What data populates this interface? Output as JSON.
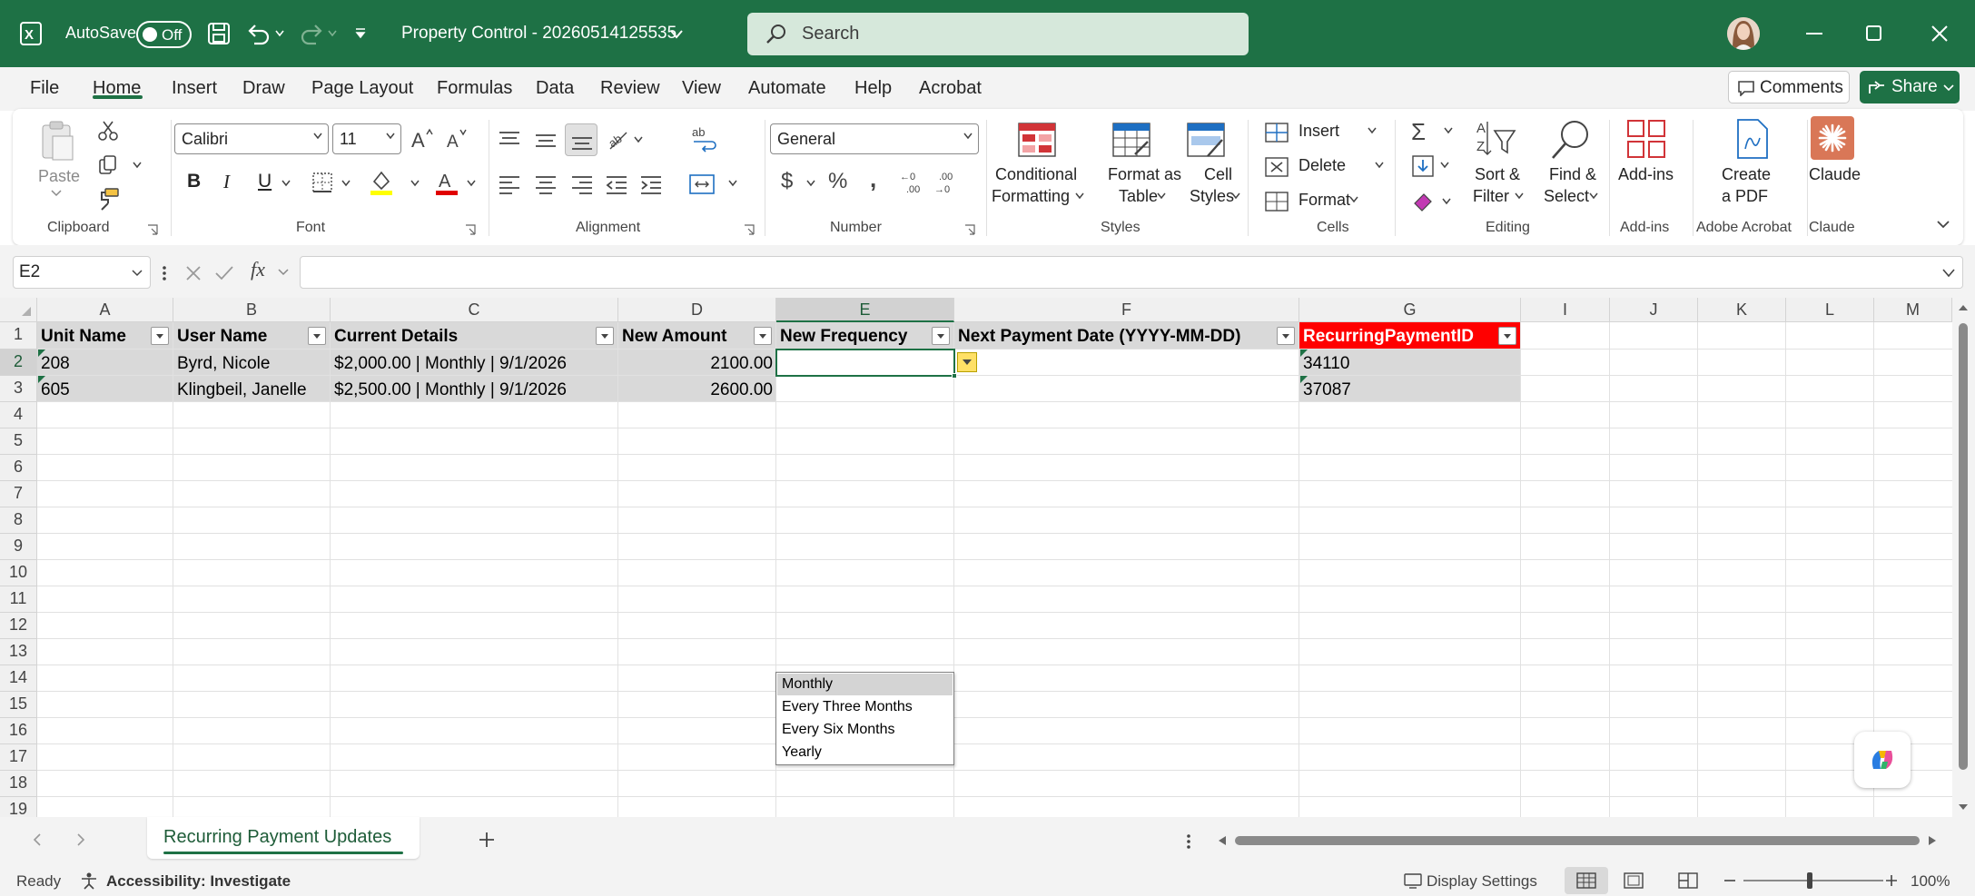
{
  "titlebar": {
    "autosave_label": "AutoSave",
    "autosave_state": "Off",
    "doc_title": "Property Control - 20260514125535",
    "search_placeholder": "Search",
    "accent": "#1e7145"
  },
  "menu": {
    "items": [
      "File",
      "Home",
      "Insert",
      "Draw",
      "Page Layout",
      "Formulas",
      "Data",
      "Review",
      "View",
      "Automate",
      "Help",
      "Acrobat"
    ],
    "active": "Home",
    "comments": "Comments",
    "share": "Share"
  },
  "ribbon": {
    "clipboard": {
      "paste": "Paste",
      "group": "Clipboard"
    },
    "font": {
      "family": "Calibri",
      "size": "11",
      "group": "Font",
      "bold": "B",
      "italic": "I",
      "underline": "U"
    },
    "alignment": {
      "group": "Alignment"
    },
    "number": {
      "format": "General",
      "group": "Number"
    },
    "styles": {
      "cond1": "Conditional",
      "cond2": "Formatting",
      "fat1": "Format as",
      "fat2": "Table",
      "cs1": "Cell",
      "cs2": "Styles",
      "group": "Styles"
    },
    "cells": {
      "insert": "Insert",
      "delete": "Delete",
      "format": "Format",
      "group": "Cells"
    },
    "editing": {
      "sort1": "Sort &",
      "sort2": "Filter",
      "find1": "Find &",
      "find2": "Select",
      "group": "Editing"
    },
    "addins": {
      "label": "Add-ins",
      "group": "Add-ins"
    },
    "acrobat": {
      "l1": "Create",
      "l2": "a PDF",
      "group": "Adobe Acrobat"
    },
    "claude": {
      "label": "Claude",
      "group": "Claude"
    }
  },
  "formula_bar": {
    "name_box": "E2",
    "fx": "fx",
    "content": ""
  },
  "sheet": {
    "columns": [
      "A",
      "B",
      "C",
      "D",
      "E",
      "F",
      "G",
      "I",
      "J",
      "K",
      "L",
      "M"
    ],
    "rows": [
      "1",
      "2",
      "3",
      "4",
      "5",
      "6",
      "7",
      "8",
      "9",
      "10",
      "11",
      "12",
      "13",
      "14",
      "15",
      "16",
      "17",
      "18",
      "19"
    ],
    "headers": [
      "Unit Name",
      "User Name",
      "Current Details",
      "New Amount",
      "New Frequency",
      "Next Payment Date (YYYY-MM-DD)",
      "RecurringPaymentID"
    ],
    "data": [
      [
        "208",
        "Byrd, Nicole",
        "$2,000.00 | Monthly | 9/1/2026",
        "2100.00",
        "",
        "",
        "34110"
      ],
      [
        "605",
        "Klingbeil, Janelle",
        "$2,500.00 | Monthly | 9/1/2026",
        "2600.00",
        "",
        "",
        "37087"
      ]
    ],
    "highlight_header_color": "#ff0000",
    "dropdown_options": [
      "Monthly",
      "Every Three Months",
      "Every Six Months",
      "Yearly"
    ],
    "dropdown_highlighted": "Monthly"
  },
  "tabs": {
    "active_sheet": "Recurring Payment Updates"
  },
  "status": {
    "ready": "Ready",
    "accessibility": "Accessibility: Investigate",
    "display_settings": "Display Settings",
    "zoom": "100%"
  }
}
